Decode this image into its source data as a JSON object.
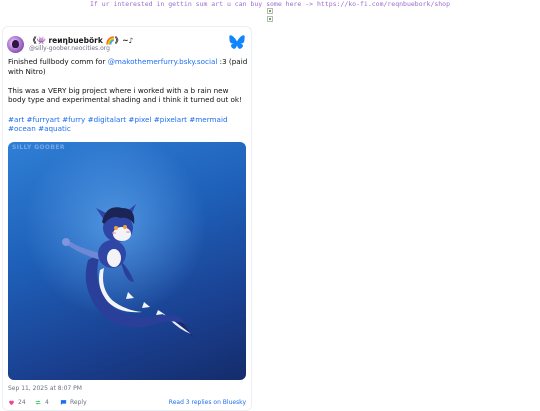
{
  "banner": {
    "text": "If ur interested in gettin sum art u can buy some here -> https://ko-fi.com/reqnbuebork/shop"
  },
  "post": {
    "author": {
      "display_name": "《👾 reиηbuebörk 🌈》~♪",
      "handle": "@silly-goober.neocities.org"
    },
    "paragraphs": {
      "p1_prefix": "Finished fullbody comm for ",
      "p1_mention": "@makothemerfurry.bsky.social",
      "p1_suffix": " :3 (paid with Nitro)",
      "p2": "This was a VERY big project where i worked with a b rain new body type and experimental shading and i think it turned out ok!"
    },
    "hashtags": [
      "#art",
      "#furryart",
      "#furry",
      "#digitalart",
      "#pixel",
      "#pixelart",
      "#mermaid",
      "#ocean",
      "#aquatic"
    ],
    "image_watermark": "SILLY GOOBER",
    "timestamp": "Sep 11, 2025 at 8:07 PM",
    "actions": {
      "likes": "24",
      "reposts": "4",
      "reply_label": "Reply",
      "read_replies_label": "Read 3 replies on Bluesky"
    }
  },
  "colors": {
    "accent": "#1d6ff0",
    "banner_text": "#9b6bd0",
    "like_heart": "#ec4899",
    "repost": "#22c55e",
    "bluesky_butterfly": "#1185fe"
  },
  "icons": [
    "bluesky-butterfly-icon",
    "heart-icon",
    "repost-icon",
    "reply-icon",
    "broken-image-icon"
  ]
}
